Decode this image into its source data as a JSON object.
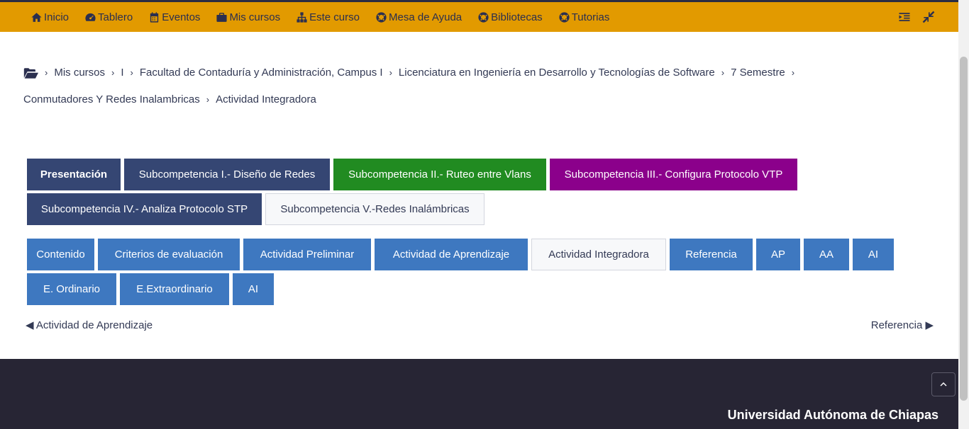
{
  "navbar": {
    "items": [
      {
        "label": "Inicio",
        "icon": "home-icon"
      },
      {
        "label": "Tablero",
        "icon": "dashboard-icon"
      },
      {
        "label": "Eventos",
        "icon": "calendar-icon"
      },
      {
        "label": "Mis cursos",
        "icon": "briefcase-icon"
      },
      {
        "label": "Este curso",
        "icon": "sitemap-icon"
      },
      {
        "label": "Mesa de Ayuda",
        "icon": "lifering-icon"
      },
      {
        "label": "Bibliotecas",
        "icon": "lifering-icon"
      },
      {
        "label": "Tutorias",
        "icon": "lifering-icon"
      }
    ],
    "accent_color": "#e29a00"
  },
  "breadcrumb": {
    "row1": [
      "Mis cursos",
      "I",
      "Facultad de Contaduría y Administración, Campus I",
      "Licenciatura en Ingeniería en Desarrollo y Tecnologías de Software",
      "7 Semestre"
    ],
    "row2": [
      "Conmutadores Y Redes Inalambricas",
      "Actividad Integradora"
    ]
  },
  "section_tabs": [
    {
      "label": "Presentación"
    },
    {
      "label": "Subcompetencia I.- Diseño de Redes"
    },
    {
      "label": "Subcompetencia II.- Ruteo entre Vlans"
    },
    {
      "label": "Subcompetencia III.- Configura Protocolo VTP"
    },
    {
      "label": "Subcompetencia IV.- Analiza Protocolo STP"
    },
    {
      "label": "Subcompetencia V.-Redes Inalámbricas"
    }
  ],
  "activity_tabs": [
    {
      "label": "Contenido"
    },
    {
      "label": "Criterios de evaluación"
    },
    {
      "label": "Actividad Preliminar"
    },
    {
      "label": "Actividad de Aprendizaje"
    },
    {
      "label": "Actividad Integradora"
    },
    {
      "label": "Referencia"
    },
    {
      "label": "AP"
    },
    {
      "label": "AA"
    },
    {
      "label": "AI"
    },
    {
      "label": "E. Ordinario"
    },
    {
      "label": "E.Extraordinario"
    },
    {
      "label": "AI"
    }
  ],
  "pager": {
    "prev": "◀ Actividad de Aprendizaje",
    "next": "Referencia ▶"
  },
  "footer": {
    "title": "Universidad Autónoma de Chiapas"
  }
}
